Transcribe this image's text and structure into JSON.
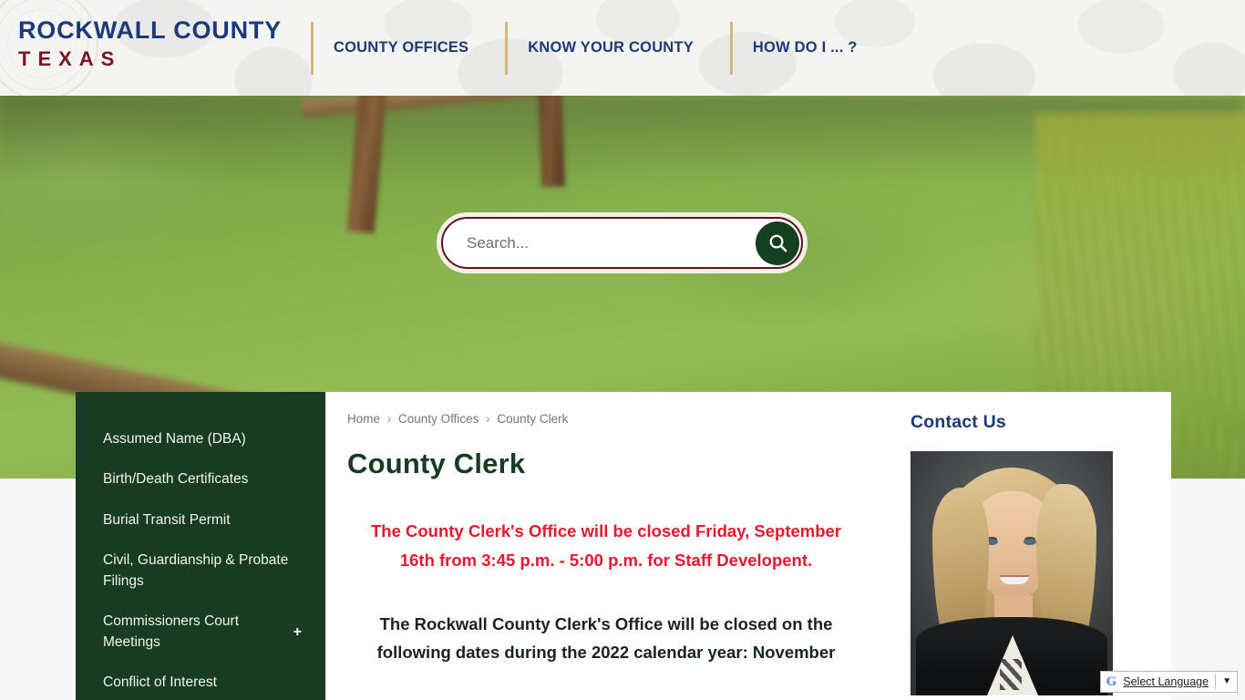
{
  "header": {
    "brand_line1": "ROCKWALL COUNTY",
    "brand_line2": "TEXAS",
    "seal_icon": "county-seal-watermark",
    "nav": [
      {
        "label": "COUNTY OFFICES"
      },
      {
        "label": "KNOW YOUR COUNTY"
      },
      {
        "label": "HOW DO I ... ?"
      }
    ],
    "colors": {
      "brand_blue": "#1b3a79",
      "brand_maroon": "#7a1422",
      "divider_tan": "#dcb579"
    }
  },
  "hero": {
    "search": {
      "placeholder": "Search...",
      "value": "",
      "button_icon": "search-icon",
      "button_color": "#14401f",
      "border_color": "#5e1420"
    }
  },
  "sidebar": {
    "items": [
      {
        "label": "Assumed Name (DBA)",
        "expander": ""
      },
      {
        "label": "Birth/Death Certificates",
        "expander": ""
      },
      {
        "label": "Burial Transit Permit",
        "expander": ""
      },
      {
        "label": "Civil, Guardianship & Probate Filings",
        "expander": ""
      },
      {
        "label": "Commissioners Court Meetings",
        "expander": "+"
      },
      {
        "label": "Conflict of Interest",
        "expander": ""
      }
    ],
    "background_color": "#183c21"
  },
  "main": {
    "breadcrumb": {
      "home": "Home",
      "sep1": "›",
      "parent": "County Offices",
      "sep2": "›",
      "current": "County Clerk"
    },
    "page_title": "County Clerk",
    "alert_text": "The County Clerk's Office will be closed Friday, September 16th from 3:45 p.m. - 5:00 p.m. for Staff Developent.",
    "alert_color": "#e8192c",
    "body_text": "The Rockwall County Clerk's Office will be closed on the following dates during the 2022 calendar year: November"
  },
  "contact": {
    "heading": "Contact Us",
    "heading_color": "#1b3a79",
    "portrait_alt": "county-clerk-portrait"
  },
  "translate": {
    "logo_icon": "google-g-icon",
    "label": "Select Language",
    "caret_icon": "chevron-down-icon",
    "caret_glyph": "▼"
  }
}
